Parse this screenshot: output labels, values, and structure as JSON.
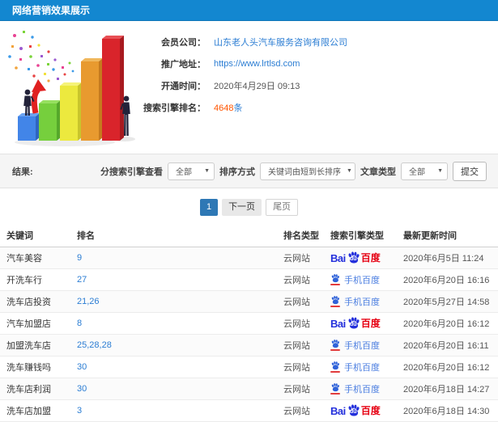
{
  "header": {
    "title": "网络营销效果展示"
  },
  "info": {
    "member_label": "会员公司：",
    "member_value": "山东老人头汽车服务咨询有限公司",
    "url_label": "推广地址：",
    "url_value": "https://www.lrtlsd.com",
    "open_label": "开通时间：",
    "open_value": "2020年4月29日 09:13",
    "rank_label": "搜索引擎排名：",
    "rank_count": "4648",
    "rank_unit": "条"
  },
  "filters": {
    "result_label": "结果:",
    "engine_view_label": "分搜索引擎查看",
    "engine_view_value": "全部",
    "sort_label": "排序方式",
    "sort_value": "关键词由短到长排序",
    "article_label": "文章类型",
    "article_value": "全部",
    "submit_label": "提交"
  },
  "pagination": {
    "current": "1",
    "next": "下一页",
    "last": "尾页"
  },
  "logos": {
    "baidu": {
      "bai": "Bai",
      "du": "du",
      "cn": "百度"
    },
    "mobile": {
      "text": "手机百度"
    }
  },
  "table": {
    "columns": [
      "关键词",
      "排名",
      "排名类型",
      "搜索引擎类型",
      "最新更新时间"
    ],
    "rows": [
      {
        "keyword": "汽车美容",
        "rank": "9",
        "rank_type": "云网站",
        "engine": "baidu",
        "updated": "2020年6月5日 11:24"
      },
      {
        "keyword": "开洗车行",
        "rank": "27",
        "rank_type": "云网站",
        "engine": "mobile",
        "updated": "2020年6月20日 16:16"
      },
      {
        "keyword": "洗车店投资",
        "rank": "21,26",
        "rank_type": "云网站",
        "engine": "mobile",
        "updated": "2020年5月27日 14:58"
      },
      {
        "keyword": "汽车加盟店",
        "rank": "8",
        "rank_type": "云网站",
        "engine": "baidu",
        "updated": "2020年6月20日 16:12"
      },
      {
        "keyword": "加盟洗车店",
        "rank": "25,28,28",
        "rank_type": "云网站",
        "engine": "mobile",
        "updated": "2020年6月20日 16:11"
      },
      {
        "keyword": "洗车赚钱吗",
        "rank": "30",
        "rank_type": "云网站",
        "engine": "mobile",
        "updated": "2020年6月20日 16:12"
      },
      {
        "keyword": "洗车店利润",
        "rank": "30",
        "rank_type": "云网站",
        "engine": "mobile",
        "updated": "2020年6月18日 14:27"
      },
      {
        "keyword": "洗车店加盟",
        "rank": "3",
        "rank_type": "云网站",
        "engine": "baidu",
        "updated": "2020年6月18日 14:30"
      }
    ]
  }
}
